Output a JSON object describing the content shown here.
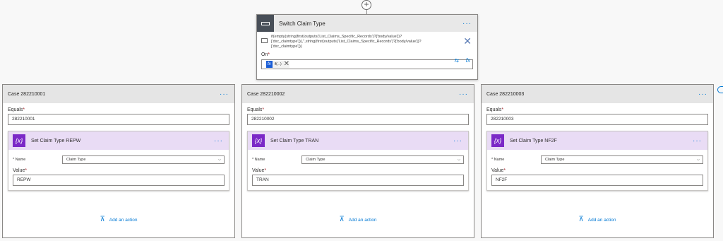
{
  "switch": {
    "title": "Switch Claim Type",
    "menu": "···",
    "expression_lines": [
      "if(empty(string(first(outputs('List_Claims_Specific_Records')?['body/value'])?",
      "['dxc_claimtype'])),'',string(first(outputs('List_Claims_Specific_Records')?['body/value'])?",
      "['dxc_claimtype']))"
    ],
    "on_label": "On",
    "on_required": "*",
    "chip_fx": "fx",
    "chip_label": "if(...)",
    "chip_close": "✕",
    "close_icon": "✕",
    "fx_tool": "fx",
    "wrap_tool": "⇆"
  },
  "cases": [
    {
      "title": "Case 282210001",
      "menu": "···",
      "equals_label": "Equals",
      "equals_value": "282210001",
      "action_title": "Set Claim Type REPW",
      "action_icon": "{x}",
      "action_menu": "···",
      "name_label": "* Name",
      "name_value": "Claim Type",
      "value_label": "Value",
      "value_value": "REPW",
      "add_label": "Add an action"
    },
    {
      "title": "Case 282210002",
      "menu": "···",
      "equals_label": "Equals",
      "equals_value": "282210002",
      "action_title": "Set Claim Type TRAN",
      "action_icon": "{x}",
      "action_menu": "···",
      "name_label": "* Name",
      "name_value": "Claim Type",
      "value_label": "Value",
      "value_value": "TRAN",
      "add_label": "Add an action"
    },
    {
      "title": "Case 282210003",
      "menu": "···",
      "equals_label": "Equals",
      "equals_value": "282210003",
      "action_title": "Set Claim Type NF2F",
      "action_icon": "{x}",
      "action_menu": "···",
      "name_label": "* Name",
      "name_value": "Claim Type",
      "value_label": "Value",
      "value_value": "NF2F",
      "add_label": "Add an action"
    }
  ],
  "required_mark": "*",
  "chevron": "⌵",
  "plus": "+",
  "add_icon": "⊼"
}
